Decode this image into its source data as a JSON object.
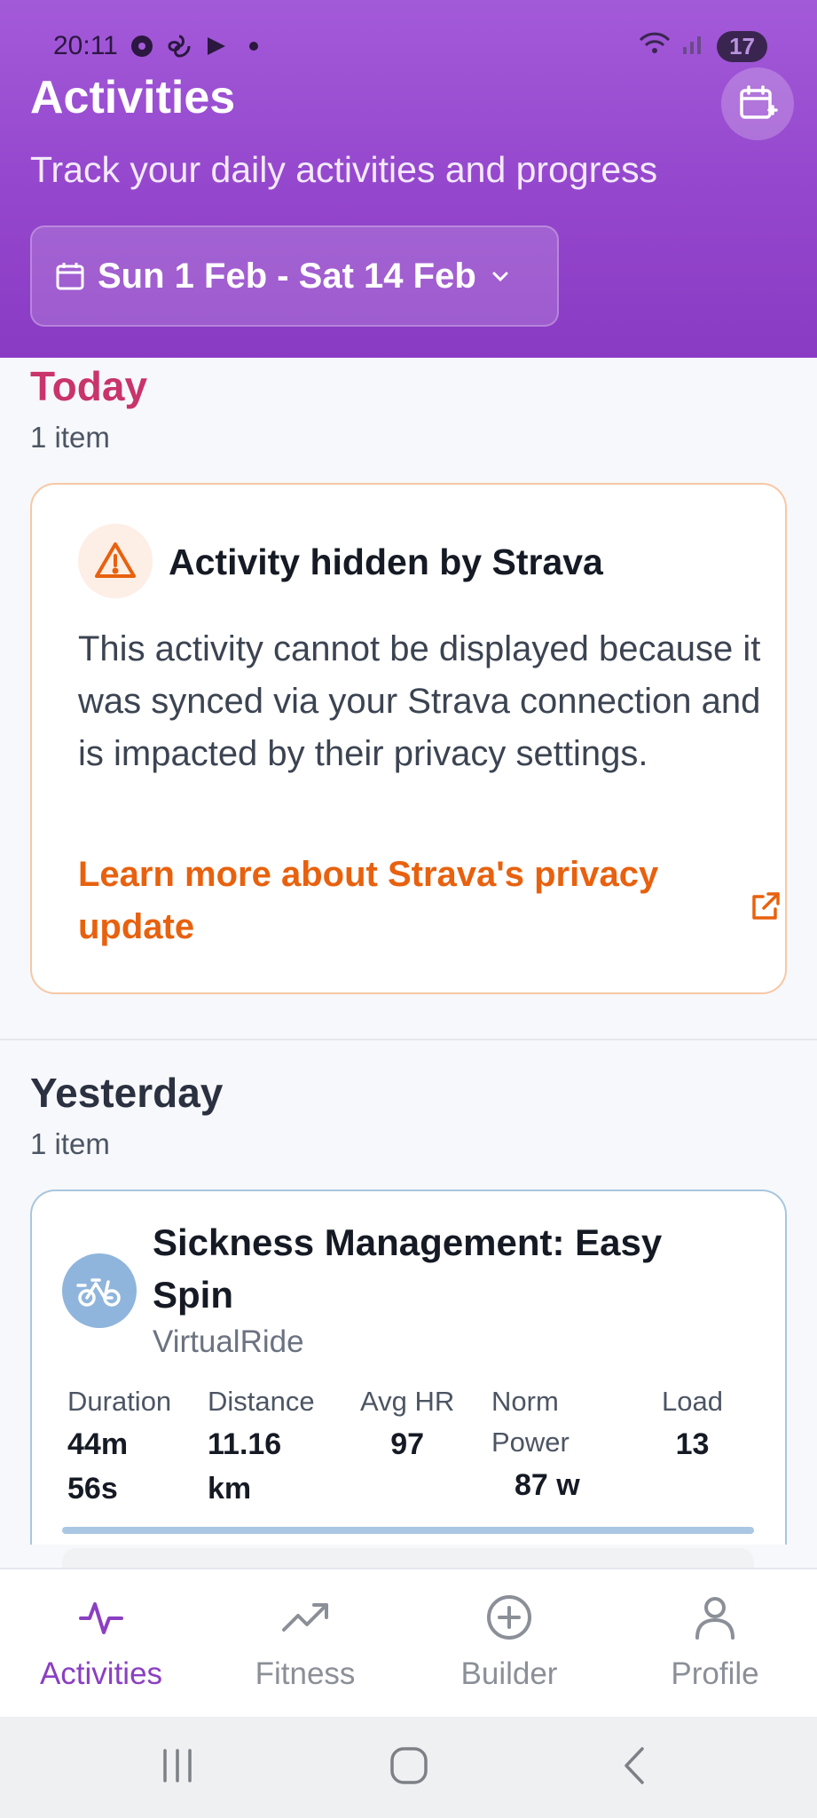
{
  "status_bar": {
    "time": "20:11",
    "battery": "17"
  },
  "header": {
    "title": "Activities",
    "subtitle": "Track your daily activities and progress",
    "date_range": "Sun 1 Feb - Sat 14 Feb",
    "gradient_top": "#a35ad9",
    "gradient_bottom": "#8a3bc4"
  },
  "today": {
    "title": "Today",
    "count": "1 item",
    "title_color": "#c9346a",
    "card": {
      "title": "Activity hidden by Strava",
      "body": "This activity cannot be displayed because it was synced via your Strava connection and is impacted by their privacy settings.",
      "link": "Learn more about Strava's privacy update",
      "accent": "#e8610e"
    }
  },
  "yesterday": {
    "title": "Yesterday",
    "count": "1 item",
    "activity": {
      "title": "Sickness Management: Easy Spin",
      "type": "VirtualRide",
      "stats": [
        {
          "label": "Duration",
          "value": "44m\n56s"
        },
        {
          "label": "Distance",
          "value": "11.16\nkm"
        },
        {
          "label": "Avg HR",
          "value": "97"
        },
        {
          "label": "Norm\nPower",
          "value": "87 w"
        },
        {
          "label": "Load",
          "value": "13"
        }
      ]
    }
  },
  "nav": {
    "items": [
      {
        "label": "Activities",
        "icon": "activity-icon",
        "active": true
      },
      {
        "label": "Fitness",
        "icon": "trending-up-icon",
        "active": false
      },
      {
        "label": "Builder",
        "icon": "plus-circle-icon",
        "active": false
      },
      {
        "label": "Profile",
        "icon": "user-icon",
        "active": false
      }
    ],
    "active_color": "#8b3fc1"
  }
}
